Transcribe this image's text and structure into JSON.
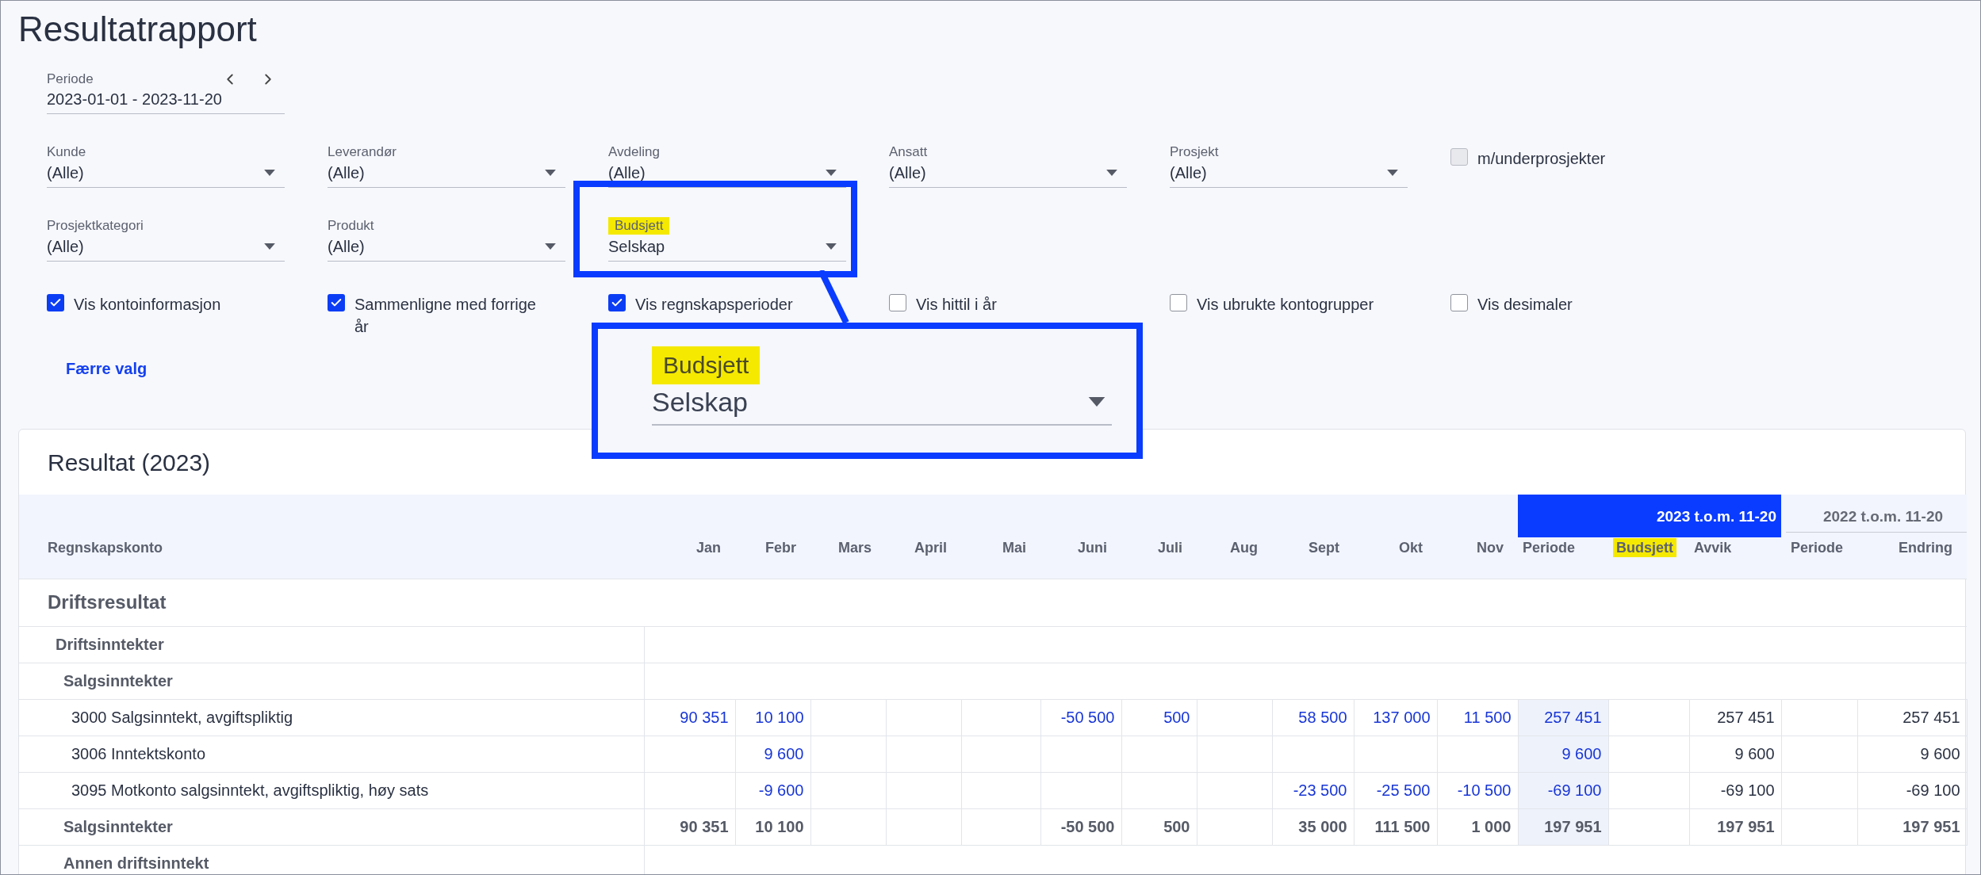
{
  "page_title": "Resultatrapport",
  "period": {
    "label": "Periode",
    "value": "2023-01-01 - 2023-11-20"
  },
  "filters": [
    {
      "kind": "select",
      "label": "Kunde",
      "value": "(Alle)",
      "highlighted": false
    },
    {
      "kind": "select",
      "label": "Leverandør",
      "value": "(Alle)",
      "highlighted": false
    },
    {
      "kind": "select",
      "label": "Avdeling",
      "value": "(Alle)",
      "highlighted": false
    },
    {
      "kind": "select",
      "label": "Ansatt",
      "value": "(Alle)",
      "highlighted": false
    },
    {
      "kind": "select",
      "label": "Prosjekt",
      "value": "(Alle)",
      "highlighted": false
    },
    {
      "kind": "checkbox",
      "label": "m/underprosjekter",
      "checked": false,
      "disabled": true
    },
    {
      "kind": "select",
      "label": "Prosjektkategori",
      "value": "(Alle)",
      "highlighted": false
    },
    {
      "kind": "select",
      "label": "Produkt",
      "value": "(Alle)",
      "highlighted": false
    },
    {
      "kind": "select",
      "label": "Budsjett",
      "value": "Selskap",
      "highlighted": true
    }
  ],
  "options": [
    {
      "label": "Vis kontoinformasjon",
      "checked": true
    },
    {
      "label": "Sammenligne med forrige år",
      "checked": true
    },
    {
      "label": "Vis regnskapsperioder",
      "checked": true
    },
    {
      "label": "Vis hittil i år",
      "checked": false
    },
    {
      "label": "Vis ubrukte kontogrupper",
      "checked": false
    },
    {
      "label": "Vis desimaler",
      "checked": false
    }
  ],
  "fewer_options_link": "Færre valg",
  "callout": {
    "label": "Budsjett",
    "value": "Selskap"
  },
  "report": {
    "title": "Resultat (2023)",
    "column_groups": [
      {
        "label": "2023 t.o.m. 11-20",
        "selected": true
      },
      {
        "label": "2022 t.o.m. 11-20",
        "selected": false
      }
    ],
    "account_header": "Regnskapskonto",
    "columns": [
      {
        "label": "Jan",
        "kind": "month",
        "highlighted": false
      },
      {
        "label": "Febr",
        "kind": "month",
        "highlighted": false
      },
      {
        "label": "Mars",
        "kind": "month",
        "highlighted": false
      },
      {
        "label": "April",
        "kind": "month",
        "highlighted": false
      },
      {
        "label": "Mai",
        "kind": "month",
        "highlighted": false
      },
      {
        "label": "Juni",
        "kind": "month",
        "highlighted": false
      },
      {
        "label": "Juli",
        "kind": "month",
        "highlighted": false
      },
      {
        "label": "Aug",
        "kind": "month",
        "highlighted": false
      },
      {
        "label": "Sept",
        "kind": "month",
        "highlighted": false
      },
      {
        "label": "Okt",
        "kind": "month",
        "highlighted": false
      },
      {
        "label": "Nov",
        "kind": "month",
        "highlighted": false
      },
      {
        "label": "Periode",
        "kind": "period",
        "highlighted": false
      },
      {
        "label": "Budsjett",
        "kind": "budget",
        "highlighted": true
      },
      {
        "label": "Avvik",
        "kind": "deviation",
        "highlighted": false
      },
      {
        "label": "Periode",
        "kind": "prior_period",
        "highlighted": false
      },
      {
        "label": "Endring",
        "kind": "change",
        "highlighted": false
      }
    ],
    "rows": [
      {
        "kind": "section",
        "label": "Driftsresultat",
        "children": [
          {
            "kind": "group",
            "label": "Driftsinntekter",
            "children": [
              {
                "kind": "group",
                "label": "Salgsinntekter",
                "children": [
                  {
                    "kind": "account",
                    "label": "3000 Salgsinntekt, avgiftspliktig",
                    "values": {
                      "0": "90 351",
                      "1": "10 100",
                      "5": "-50 500",
                      "6": "500",
                      "8": "58 500",
                      "9": "137 000",
                      "10": "11 500",
                      "11": "257 451",
                      "13": "257 451",
                      "15": "257 451"
                    }
                  },
                  {
                    "kind": "account",
                    "label": "3006 Inntektskonto",
                    "values": {
                      "1": "9 600",
                      "11": "9 600",
                      "13": "9 600",
                      "15": "9 600"
                    }
                  },
                  {
                    "kind": "account",
                    "label": "3095 Motkonto salgsinntekt, avgiftspliktig, høy sats",
                    "values": {
                      "1": "-9 600",
                      "8": "-23 500",
                      "9": "-25 500",
                      "10": "-10 500",
                      "11": "-69 100",
                      "13": "-69 100",
                      "15": "-69 100"
                    }
                  },
                  {
                    "kind": "sum",
                    "label": "Salgsinntekter",
                    "values": {
                      "0": "90 351",
                      "1": "10 100",
                      "5": "-50 500",
                      "6": "500",
                      "8": "35 000",
                      "9": "111 500",
                      "10": "1 000",
                      "11": "197 951",
                      "13": "197 951",
                      "15": "197 951"
                    }
                  }
                ]
              },
              {
                "kind": "group",
                "label": "Annen driftsinntekt"
              }
            ]
          }
        ]
      }
    ]
  }
}
